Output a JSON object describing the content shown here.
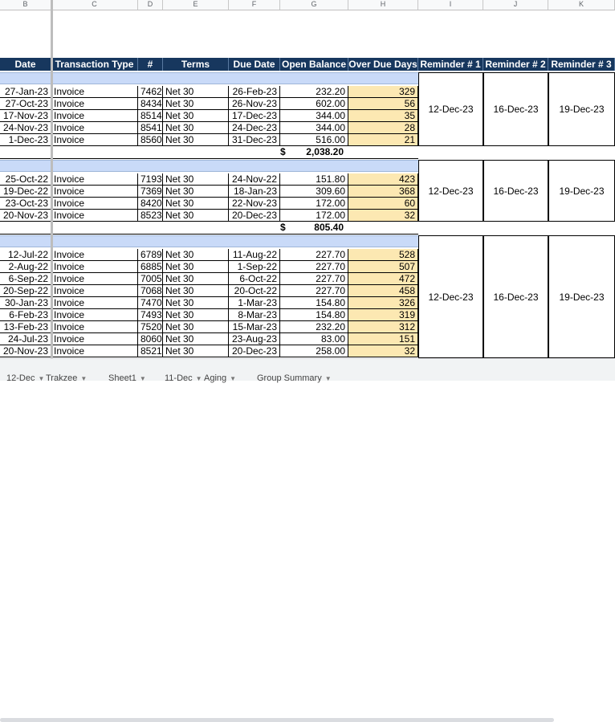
{
  "column_letters": [
    "B",
    "C",
    "D",
    "E",
    "F",
    "G",
    "H",
    "I",
    "J",
    "K"
  ],
  "headers": [
    "Date",
    "Transaction Type",
    "#",
    "Terms",
    "Due Date",
    "Open Balance",
    "Over Due Days",
    "Reminder # 1",
    "Reminder # 2",
    "Reminder # 3"
  ],
  "groups": [
    {
      "rows": [
        [
          "27-Jan-23",
          "Invoice",
          "7462",
          "Net 30",
          "26-Feb-23",
          "232.20",
          "329"
        ],
        [
          "27-Oct-23",
          "Invoice",
          "8434",
          "Net 30",
          "26-Nov-23",
          "602.00",
          "56"
        ],
        [
          "17-Nov-23",
          "Invoice",
          "8514",
          "Net 30",
          "17-Dec-23",
          "344.00",
          "35"
        ],
        [
          "24-Nov-23",
          "Invoice",
          "8541",
          "Net 30",
          "24-Dec-23",
          "344.00",
          "28"
        ],
        [
          "1-Dec-23",
          "Invoice",
          "8560",
          "Net 30",
          "31-Dec-23",
          "516.00",
          "21"
        ]
      ],
      "total_symbol": "$",
      "total": "2,038.20",
      "reminders": [
        "12-Dec-23",
        "16-Dec-23",
        "19-Dec-23"
      ]
    },
    {
      "rows": [
        [
          "25-Oct-22",
          "Invoice",
          "7193",
          "Net 30",
          "24-Nov-22",
          "151.80",
          "423"
        ],
        [
          "19-Dec-22",
          "Invoice",
          "7369",
          "Net 30",
          "18-Jan-23",
          "309.60",
          "368"
        ],
        [
          "23-Oct-23",
          "Invoice",
          "8420",
          "Net 30",
          "22-Nov-23",
          "172.00",
          "60"
        ],
        [
          "20-Nov-23",
          "Invoice",
          "8523",
          "Net 30",
          "20-Dec-23",
          "172.00",
          "32"
        ]
      ],
      "total_symbol": "$",
      "total": "805.40",
      "reminders": [
        "12-Dec-23",
        "16-Dec-23",
        "19-Dec-23"
      ]
    },
    {
      "rows": [
        [
          "12-Jul-22",
          "Invoice",
          "6789",
          "Net 30",
          "11-Aug-22",
          "227.70",
          "528"
        ],
        [
          "2-Aug-22",
          "Invoice",
          "6885",
          "Net 30",
          "1-Sep-22",
          "227.70",
          "507"
        ],
        [
          "6-Sep-22",
          "Invoice",
          "7005",
          "Net 30",
          "6-Oct-22",
          "227.70",
          "472"
        ],
        [
          "20-Sep-22",
          "Invoice",
          "7068",
          "Net 30",
          "20-Oct-22",
          "227.70",
          "458"
        ],
        [
          "30-Jan-23",
          "Invoice",
          "7470",
          "Net 30",
          "1-Mar-23",
          "154.80",
          "326"
        ],
        [
          "6-Feb-23",
          "Invoice",
          "7493",
          "Net 30",
          "8-Mar-23",
          "154.80",
          "319"
        ],
        [
          "13-Feb-23",
          "Invoice",
          "7520",
          "Net 30",
          "15-Mar-23",
          "232.20",
          "312"
        ],
        [
          "24-Jul-23",
          "Invoice",
          "8060",
          "Net 30",
          "23-Aug-23",
          "83.00",
          "151"
        ],
        [
          "20-Nov-23",
          "Invoice",
          "8521",
          "Net 30",
          "20-Dec-23",
          "258.00",
          "32"
        ]
      ],
      "reminders": [
        "12-Dec-23",
        "16-Dec-23",
        "19-Dec-23"
      ]
    }
  ],
  "sheet_tabs": [
    "12-Dec",
    "Trakzee",
    "Sheet1",
    "11-Dec",
    "Aging",
    "Group Summary"
  ],
  "colors": {
    "header_bg": "#17375e",
    "band_bg": "#c9daf8",
    "overdue_bg": "#fce8b2"
  }
}
